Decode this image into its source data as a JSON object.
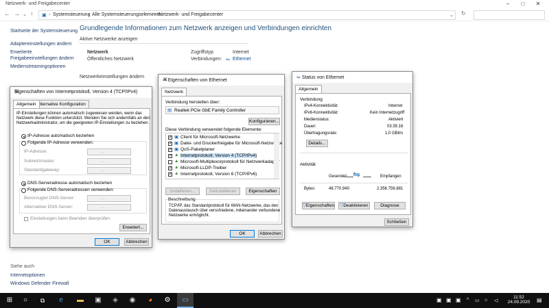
{
  "window": {
    "title": "Netzwerk- und Freigabecenter",
    "breadcrumb": [
      "Systemsteuerung",
      "Alle Systemsteuerungselemente",
      "Netzwerk- und Freigabecenter"
    ]
  },
  "leftnav": {
    "items": [
      "Startseite der Systemsteuerung",
      "Adaptereinstellungen ändern",
      "Erweiterte",
      "Freigabeeinstellungen ändern",
      "Medienstreamingoptionen"
    ],
    "see_also_label": "Siehe auch",
    "see_also": [
      "Internetoptionen",
      "Windows Defender Firewall"
    ]
  },
  "main": {
    "heading": "Grundlegende Informationen zum Netzwerk anzeigen und Verbindungen einrichten",
    "active_label": "Aktive Netzwerke anzeigen",
    "network_name": "Netzwerk",
    "network_type": "Öffentliches Netzwerk",
    "access_type_label": "Zugriffstyp:",
    "access_type_value": "Internet",
    "connections_label": "Verbindungen:",
    "connections_value": "Ethernet",
    "settings_label": "Netzwerkeinstellungen ändern"
  },
  "ipv4": {
    "title": "Eigenschaften von Internetprotokoll, Version 4 (TCP/IPv4)",
    "tabs": [
      "Allgemein",
      "Alternative Konfiguration"
    ],
    "intro": [
      "IP-Einstellungen können automatisch zugewiesen werden, wenn das",
      "Netzwerk diese Funktion unterstützt. Wenden Sie sich andernfalls an den",
      "Netzwerkadministrator, um die geeigneten IP-Einstellungen zu beziehen."
    ],
    "radio_auto_ip": "IP-Adresse automatisch beziehen",
    "radio_manual_ip": "Folgende IP-Adresse verwenden:",
    "ip_label": "IP-Adresse:",
    "subnet_label": "Subnetzmaske:",
    "gateway_label": "Standardgateway:",
    "radio_auto_dns": "DNS-Serveradresse automatisch beziehen",
    "radio_manual_dns": "Folgende DNS-Serveradressen verwenden:",
    "dns_pref_label": "Bevorzugter DNS-Server:",
    "dns_alt_label": "Alternativer DNS-Server:",
    "validate_label": "Einstellungen beim Beenden überprüfen",
    "advanced_btn": "Erweitert...",
    "ok_btn": "OK",
    "cancel_btn": "Abbrechen",
    "ip_dots": ".   .   ."
  },
  "eth_props": {
    "title": "Eigenschaften von Ethernet",
    "tab": "Netzwerk",
    "connect_using_label": "Verbindung herstellen über:",
    "adapter": "Realtek PCIe GbE Family Controller",
    "configure_btn": "Konfigurieren...",
    "items_label": "Diese Verbindung verwendet folgende Elemente:",
    "items": [
      {
        "label": "Client für Microsoft-Netzwerke",
        "checked": true
      },
      {
        "label": "Datei- und Druckerfreigabe für Microsoft-Netzwerke",
        "checked": true
      },
      {
        "label": "QoS-Paketplaner",
        "checked": true
      },
      {
        "label": "Internetprotokoll, Version 4 (TCP/IPv4)",
        "checked": true
      },
      {
        "label": "Microsoft-Multiplexorprotokoll für Netzwerkadapter",
        "checked": false
      },
      {
        "label": "Microsoft-LLDP-Treiber",
        "checked": true
      },
      {
        "label": "Internetprotokoll, Version 6 (TCP/IPv6)",
        "checked": true
      }
    ],
    "install_btn": "Installieren...",
    "uninstall_btn": "Deinstallieren",
    "properties_btn": "Eigenschaften",
    "desc_label": "Beschreibung",
    "desc": [
      "TCP/IP, das Standardprotokoll für WAN-Netzwerke, das den",
      "Datenaustausch über verschiedene, miteinander verbundene",
      "Netzwerke ermöglicht."
    ],
    "ok_btn": "OK",
    "cancel_btn": "Abbrechen"
  },
  "status": {
    "title": "Status von Ethernet",
    "tab": "Allgemein",
    "conn_label": "Verbindung",
    "rows": [
      {
        "k": "IPv4-Konnektivität:",
        "v": "Internet"
      },
      {
        "k": "IPv6-Konnektivität:",
        "v": "Kein Internetzugriff"
      },
      {
        "k": "Medienstatus:",
        "v": "Aktiviert"
      },
      {
        "k": "Dauer:",
        "v": "03:35:16"
      },
      {
        "k": "Übertragungsrate:",
        "v": "1,0 GBit/s"
      }
    ],
    "details_btn": "Details...",
    "activity_label": "Aktivität",
    "sent_label": "Gesendet",
    "received_label": "Empfangen",
    "bytes_label": "Bytes:",
    "bytes_sent": "48.770.940",
    "bytes_received": "2.356.756.881",
    "properties_btn": "Eigenschaften",
    "disable_btn": "Deaktivieren",
    "diagnose_btn": "Diagnose",
    "close_btn": "Schließen"
  },
  "taskbar": {
    "time": "11:52",
    "date": "24.09.2020"
  }
}
